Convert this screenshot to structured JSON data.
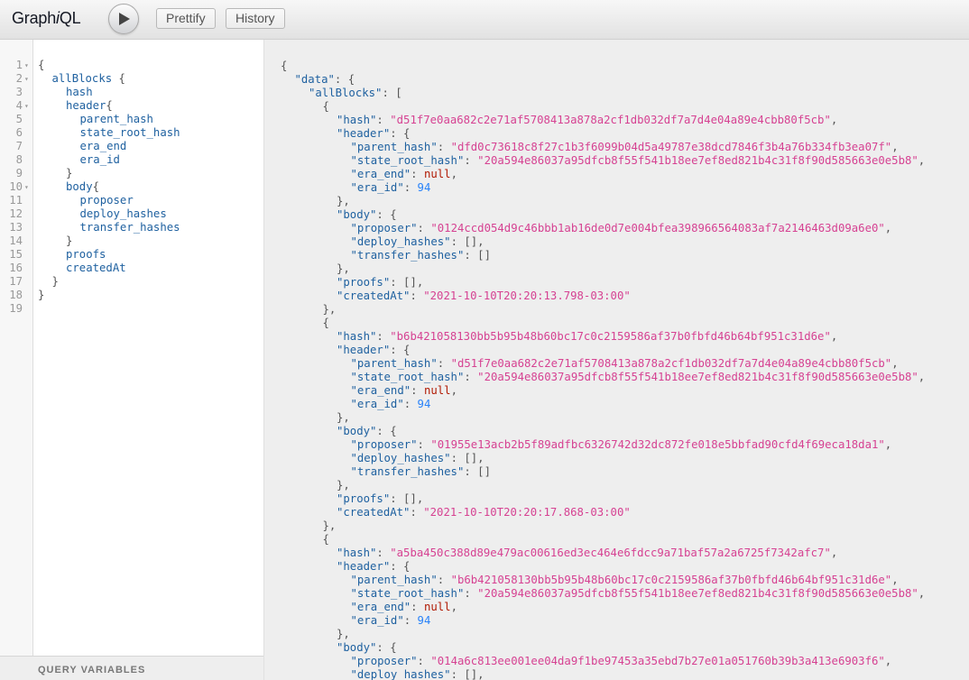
{
  "toolbar": {
    "logo_prefix": "Graph",
    "logo_italic": "i",
    "logo_suffix": "QL",
    "prettify_label": "Prettify",
    "history_label": "History"
  },
  "query_editor": {
    "lines": [
      {
        "num": "1",
        "indent": 0,
        "text": "{",
        "fold": true
      },
      {
        "num": "2",
        "indent": 1,
        "text": "allBlocks {",
        "fold": true
      },
      {
        "num": "3",
        "indent": 2,
        "text": "hash",
        "fold": false
      },
      {
        "num": "4",
        "indent": 2,
        "text": "header{",
        "fold": true
      },
      {
        "num": "5",
        "indent": 3,
        "text": "parent_hash",
        "fold": false
      },
      {
        "num": "6",
        "indent": 3,
        "text": "state_root_hash",
        "fold": false
      },
      {
        "num": "7",
        "indent": 3,
        "text": "era_end",
        "fold": false
      },
      {
        "num": "8",
        "indent": 3,
        "text": "era_id",
        "fold": false
      },
      {
        "num": "9",
        "indent": 2,
        "text": "}",
        "fold": false
      },
      {
        "num": "10",
        "indent": 2,
        "text": "body{",
        "fold": true
      },
      {
        "num": "11",
        "indent": 3,
        "text": "proposer",
        "fold": false
      },
      {
        "num": "12",
        "indent": 3,
        "text": "deploy_hashes",
        "fold": false
      },
      {
        "num": "13",
        "indent": 3,
        "text": "transfer_hashes",
        "fold": false
      },
      {
        "num": "14",
        "indent": 2,
        "text": "}",
        "fold": false
      },
      {
        "num": "15",
        "indent": 2,
        "text": "proofs",
        "fold": false
      },
      {
        "num": "16",
        "indent": 2,
        "text": "createdAt",
        "fold": false
      },
      {
        "num": "17",
        "indent": 1,
        "text": "}",
        "fold": false
      },
      {
        "num": "18",
        "indent": 0,
        "text": "}",
        "fold": false
      },
      {
        "num": "19",
        "indent": 0,
        "text": "",
        "fold": false
      }
    ]
  },
  "query_variables_label": "QUERY VARIABLES",
  "result": {
    "blocks": [
      {
        "hash": "\"d51f7e0aa682c2e71af5708413a878a2cf1db032df7a7d4e04a89e4cbb80f5cb\"",
        "parent_hash": "\"dfd0c73618c8f27c1b3f6099b04d5a49787e38dcd7846f3b4a76b334fb3ea07f\"",
        "state_root_hash": "\"20a594e86037a95dfcb8f55f541b18ee7ef8ed821b4c31f8f90d585663e0e5b8\"",
        "era_end": "null",
        "era_id": "94",
        "proposer": "\"0124ccd054d9c46bbb1ab16de0d7e004bfea398966564083af7a2146463d09a6e0\"",
        "deploy_hashes": "[],",
        "transfer_hashes": "[]",
        "proofs": "[],",
        "createdAt": "\"2021-10-10T20:20:13.798-03:00\""
      },
      {
        "hash": "\"b6b421058130bb5b95b48b60bc17c0c2159586af37b0fbfd46b64bf951c31d6e\"",
        "parent_hash": "\"d51f7e0aa682c2e71af5708413a878a2cf1db032df7a7d4e04a89e4cbb80f5cb\"",
        "state_root_hash": "\"20a594e86037a95dfcb8f55f541b18ee7ef8ed821b4c31f8f90d585663e0e5b8\"",
        "era_end": "null",
        "era_id": "94",
        "proposer": "\"01955e13acb2b5f89adfbc6326742d32dc872fe018e5bbfad90cfd4f69eca18da1\"",
        "deploy_hashes": "[],",
        "transfer_hashes": "[]",
        "proofs": "[],",
        "createdAt": "\"2021-10-10T20:20:17.868-03:00\""
      },
      {
        "hash": "\"a5ba450c388d89e479ac00616ed3ec464e6fdcc9a71baf57a2a6725f7342afc7\"",
        "parent_hash": "\"b6b421058130bb5b95b48b60bc17c0c2159586af37b0fbfd46b64bf951c31d6e\"",
        "state_root_hash": "\"20a594e86037a95dfcb8f55f541b18ee7ef8ed821b4c31f8f90d585663e0e5b8\"",
        "era_end": "null",
        "era_id": "94",
        "proposer": "\"014a6c813ee001ee04da9f1be97453a35ebd7b27e01a051760b39b3a413e6903f6\"",
        "deploy_hashes": "[],"
      }
    ]
  }
}
